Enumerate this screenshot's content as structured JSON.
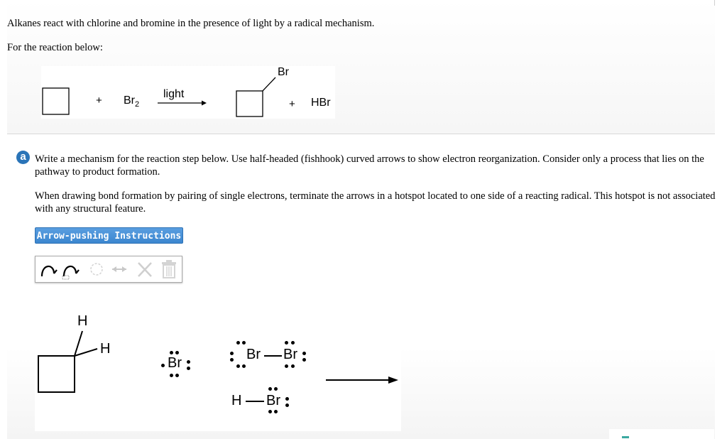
{
  "intro": {
    "sentence": "Alkanes react with chlorine and bromine in the presence of light by a radical mechanism.",
    "for_reaction": "For the reaction below:"
  },
  "reaction": {
    "plus1": "+",
    "reagent_pre": "Br",
    "reagent_sub": "2",
    "condition": "light",
    "product_sub": "Br",
    "plus2": "+",
    "byproduct": "HBr"
  },
  "part_a": {
    "badge": "a",
    "instruction": "Write a mechanism for the reaction step below. Use half-headed (fishhook) curved arrows to show electron reorganization. Consider only a process that lies on the pathway to product formation.",
    "hotspot_note": "When drawing bond formation by pairing of single electrons, terminate the arrows in a hotspot located to one side of a reacting radical. This hotspot is not associated with any structural feature.",
    "button_label": "Arrow-pushing Instructions"
  },
  "toolbar": {
    "tools": [
      "fishhook-arrow-icon",
      "selected-fishhook-arrow-icon",
      "lasso-icon",
      "double-arrow-icon",
      "close-icon",
      "trash-icon"
    ],
    "active_color": "#000000",
    "inactive_color": "#cfcfcf"
  },
  "canvas": {
    "h_top": "H",
    "h_right": "H",
    "br_radical": "Br",
    "br2_left": "Br",
    "br2_right": "Br",
    "hbr_h": "H",
    "hbr_br": "Br"
  },
  "colors": {
    "accent": "#2a74b8",
    "button": "#3b86cf"
  }
}
